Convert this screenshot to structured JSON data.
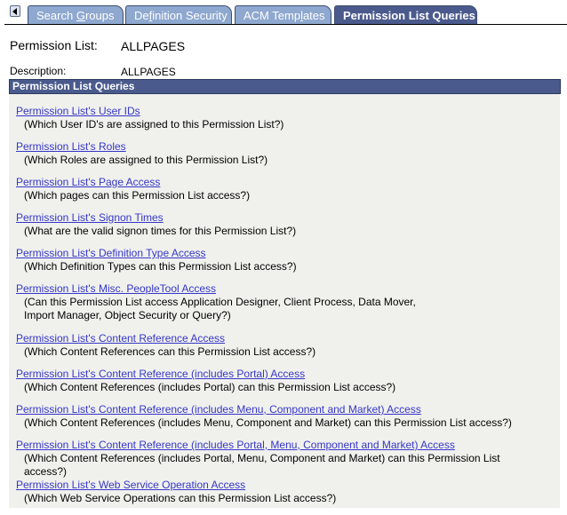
{
  "tabs": [
    {
      "label_pre": "Search ",
      "label_key": "G",
      "label_post": "roups",
      "active": false
    },
    {
      "label_pre": "De",
      "label_key": "f",
      "label_post": "inition Security",
      "active": false
    },
    {
      "label_pre": "ACM Temp",
      "label_key": "l",
      "label_post": "ates",
      "active": false
    },
    {
      "label_pre": "Permission List Queries",
      "label_key": "",
      "label_post": "",
      "active": true
    }
  ],
  "header": {
    "permission_list_label": "Permission List:",
    "permission_list_value": "ALLPAGES",
    "description_label": "Description:",
    "description_value": "ALLPAGES"
  },
  "section": {
    "title": "Permission List Queries"
  },
  "queries": [
    {
      "link": "Permission List's User IDs",
      "desc": "(Which User ID's are assigned to this Permission List?)"
    },
    {
      "link": "Permission List's Roles",
      "desc": "(Which Roles are assigned to this Permission List?)"
    },
    {
      "link": "Permission List's Page Access",
      "desc": "(Which pages can this Permission List access?)"
    },
    {
      "link": "Permission List's Signon Times",
      "desc": "(What are the valid signon times for this Permission List?)"
    },
    {
      "link": "Permission List's Definition Type Access",
      "desc": "(Which Definition Types can this Permission List access?)"
    },
    {
      "link": "Permission List's Misc. PeopleTool Access",
      "desc": "(Can this Permission List access Application Designer, Client Process, Data Mover, Import Manager, Object Security or Query?)"
    },
    {
      "link": "Permission List's Content Reference Access",
      "desc": "(Which Content References can this Permission List access?)"
    },
    {
      "link": "Permission List's Content Reference (includes Portal) Access",
      "desc": "(Which Content References (includes Portal) can this Permission List access?)"
    },
    {
      "link": "Permission List's Content Reference (includes Menu, Component and Market) Access",
      "desc": "(Which Content References (includes Menu, Component and Market) can this Permission List access?)"
    },
    {
      "link": "Permission List's Content Reference (includes Portal, Menu, Component and Market) Access",
      "desc": "(Which Content References (includes Portal, Menu, Component and Market) can this Permission List access?)"
    },
    {
      "link": "Permission List's Web Service Operation Access",
      "desc": "(Which Web Service Operations can this Permission List access?)"
    }
  ]
}
